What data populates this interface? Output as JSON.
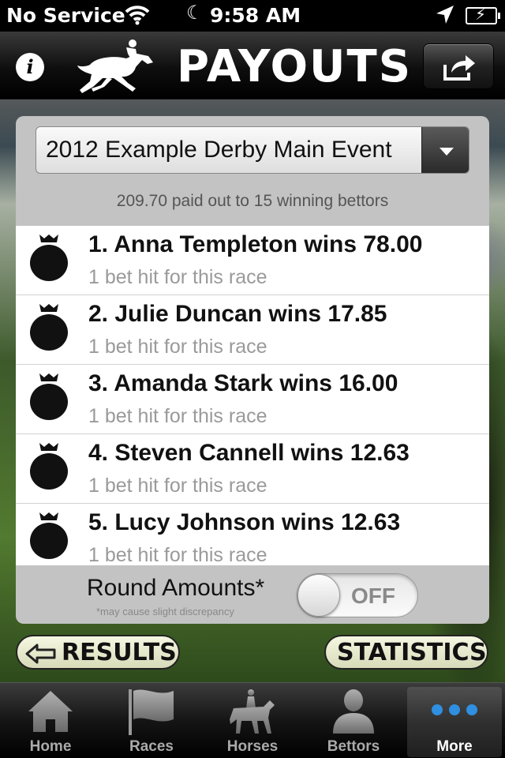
{
  "status_bar": {
    "carrier": "No Service",
    "time": "9:58 AM"
  },
  "nav": {
    "title": "PAYOUTS",
    "info_glyph": "i"
  },
  "event_select": {
    "selected": "2012 Example Derby Main Event"
  },
  "summary": "209.70 paid out to 15 winning bettors",
  "payouts": [
    {
      "title": "1. Anna Templeton wins 78.00",
      "subtitle": "1 bet hit for this race"
    },
    {
      "title": "2. Julie Duncan wins 17.85",
      "subtitle": "1 bet hit for this race"
    },
    {
      "title": "3. Amanda Stark wins 16.00",
      "subtitle": "1 bet hit for this race"
    },
    {
      "title": "4. Steven Cannell wins 12.63",
      "subtitle": "1 bet hit for this race"
    },
    {
      "title": "5. Lucy Johnson wins 12.63",
      "subtitle": "1 bet hit for this race"
    }
  ],
  "round_amounts": {
    "label": "Round Amounts*",
    "note": "*may cause slight discrepancy",
    "toggle_state": "OFF"
  },
  "buttons": {
    "results": "RESULTS",
    "statistics": "STATISTICS"
  },
  "tabs": [
    {
      "label": "Home",
      "icon": "home-icon"
    },
    {
      "label": "Races",
      "icon": "flag-icon"
    },
    {
      "label": "Horses",
      "icon": "horse-rider-icon"
    },
    {
      "label": "Bettors",
      "icon": "person-icon"
    },
    {
      "label": "More",
      "icon": "more-dots-icon",
      "active": true
    }
  ],
  "colors": {
    "accent_dots": "#2f8fe0",
    "button_fill": "#e6e9c8"
  }
}
